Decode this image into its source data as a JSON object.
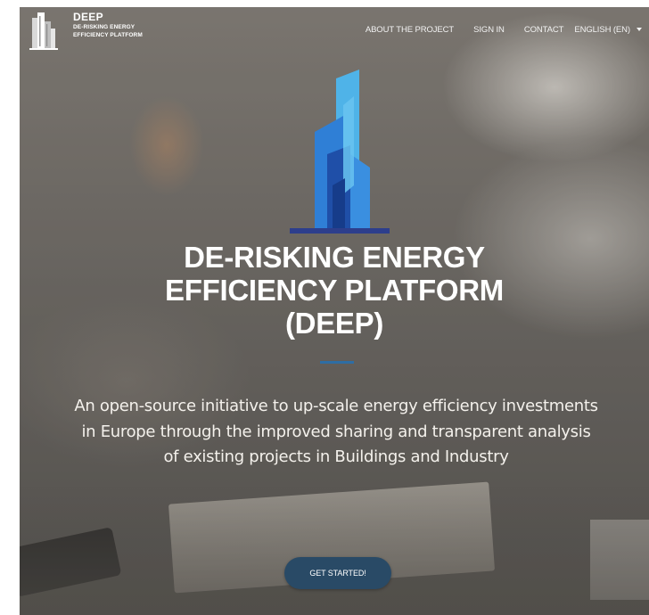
{
  "navbar": {
    "brand": {
      "name": "DEEP",
      "subtitle_line1": "DE-RISKING ENERGY",
      "subtitle_line2": "EFFICIENCY PLATFORM",
      "logo_icon": "building-icon"
    },
    "links": [
      {
        "label": "ABOUT THE PROJECT"
      },
      {
        "label": "SIGN IN"
      },
      {
        "label": "CONTACT"
      },
      {
        "label": "ENGLISH (EN)",
        "icon": "caret-down-icon"
      }
    ]
  },
  "hero": {
    "logo_icon": "skyscraper-logo-icon",
    "title_lines": [
      "DE-RISKING ENERGY",
      "EFFICIENCY PLATFORM",
      "(DEEP)"
    ],
    "subtitle": "An open-source initiative to up-scale energy efficiency investments in Europe through the improved sharing and transparent analysis of existing projects in Buildings and Industry",
    "cta_label": "GET STARTED!"
  },
  "colors": {
    "accent": "#2e6da4",
    "cta_background": "#294a66",
    "logo_blue_light": "#4fb3e8",
    "logo_blue_dark": "#1f4fa8",
    "logo_base": "#2d3e8c"
  }
}
